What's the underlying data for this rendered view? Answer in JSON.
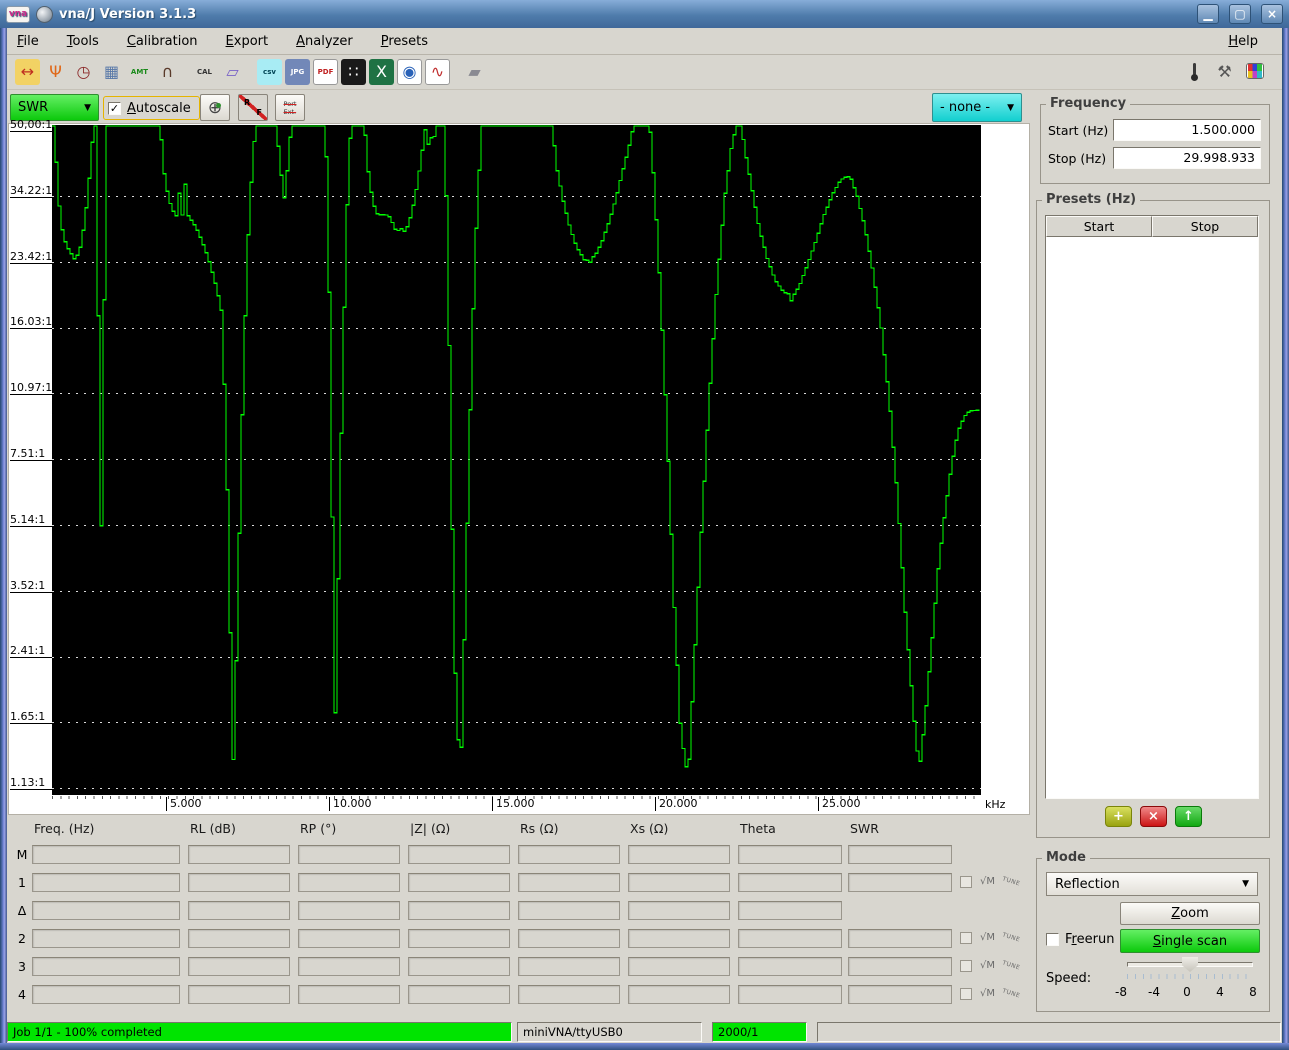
{
  "window": {
    "title": "vna/J Version 3.1.3",
    "logo": "vna"
  },
  "icons": {
    "minimize": "▁",
    "restore": "▢",
    "close": "×",
    "plus": "+",
    "delete": "×",
    "up": "↑",
    "check": "✓",
    "combo_arrow": "▼",
    "smith": "⊕",
    "sqrt_m": "√M",
    "tune": "TUNE"
  },
  "menu": {
    "items": [
      "File",
      "Tools",
      "Calibration",
      "Export",
      "Analyzer",
      "Presets"
    ],
    "help": "Help"
  },
  "toolbar": {
    "groups": [
      [
        {
          "name": "frequency-range-icon",
          "glyph": "↔",
          "fg": "#c03020",
          "bg": "#f2d264"
        },
        {
          "name": "antenna-icon",
          "glyph": "Ψ",
          "fg": "#e06818"
        },
        {
          "name": "clock-icon",
          "glyph": "◷",
          "fg": "#8c2a2a"
        },
        {
          "name": "calculator-icon",
          "glyph": "▦",
          "fg": "#5878a8"
        },
        {
          "name": "scale-letters-icon",
          "glyph": "AMT",
          "fg": "#1a8a1a",
          "small": true
        },
        {
          "name": "magnet-icon",
          "glyph": "∩",
          "fg": "#5a3a2a"
        }
      ],
      [
        {
          "name": "calibration-icon",
          "glyph": "CAL",
          "fg": "#333333",
          "small": true
        },
        {
          "name": "open-folder-icon",
          "glyph": "▱",
          "fg": "#7a62c8"
        }
      ],
      [
        {
          "name": "export-csv-icon",
          "glyph": "csv",
          "fg": "#004455",
          "bg": "#a8ecf4",
          "small": true
        },
        {
          "name": "export-jpg-icon",
          "glyph": "JPG",
          "fg": "#ffffff",
          "bg": "#7288b8",
          "small": true
        },
        {
          "name": "export-pdf-icon",
          "glyph": "PDF",
          "fg": "#c02020",
          "bg": "#ffffff",
          "bd": "#999999",
          "small": true
        },
        {
          "name": "export-sample-icon",
          "glyph": "∷",
          "fg": "#ffffff",
          "bg": "#1a1a1a"
        },
        {
          "name": "export-xls-icon",
          "glyph": "X",
          "fg": "#ffffff",
          "bg": "#1f7244"
        },
        {
          "name": "export-report-icon",
          "glyph": "◉",
          "fg": "#2a62b8",
          "bg": "#ffffff",
          "bd": "#999999"
        },
        {
          "name": "export-chart-icon",
          "glyph": "∿",
          "fg": "#c03030",
          "bg": "#ffffff",
          "bd": "#999999"
        }
      ],
      [
        {
          "name": "eraser-icon",
          "glyph": "▰",
          "fg": "#8a8a92"
        }
      ]
    ],
    "right": [
      {
        "name": "temperature-icon",
        "cls": "thermo"
      },
      {
        "name": "settings-icon",
        "glyph": "⚒",
        "fg": "#555555"
      },
      {
        "name": "color-scheme-icon",
        "cls": "palette"
      }
    ]
  },
  "scalebar": {
    "left_scale": "SWR",
    "autoscale_label": "Autoscale",
    "autoscale_checked": true,
    "right_scale": "- none -",
    "rf_r": "R",
    "rf_f": "F",
    "port_line1": "Port",
    "port_line2": "Ext."
  },
  "chart_data": {
    "type": "line",
    "x_unit": "kHz",
    "x_range_khz": [
      1500,
      29998.933
    ],
    "x_ticks": {
      "labels": [
        "5.000",
        "10.000",
        "15.000",
        "20.000",
        "25.000"
      ],
      "values_khz": [
        5000,
        10000,
        15000,
        20000,
        25000
      ]
    },
    "y_axis": {
      "scale": "log",
      "tick_labels": [
        "50,00:1",
        "34.22:1",
        "23.42:1",
        "16.03:1",
        "10.97:1",
        "7.51:1",
        "5.14:1",
        "3.52:1",
        "2.41:1",
        "1.65:1",
        "1.13:1"
      ],
      "tick_values": [
        50.0,
        34.22,
        23.42,
        16.03,
        10.97,
        7.51,
        5.14,
        3.52,
        2.41,
        1.65,
        1.13
      ]
    },
    "plot_bg": "#000000",
    "grid_color": "#ffffff",
    "clipped_at_top_swr": 50,
    "series": [
      {
        "name": "SWR",
        "color": "#00ff00",
        "points_khz_swr": [
          [
            1500,
            55
          ],
          [
            1560,
            46
          ],
          [
            1620,
            38
          ],
          [
            1700,
            31
          ],
          [
            1810,
            27
          ],
          [
            1930,
            25.5
          ],
          [
            2050,
            24.5
          ],
          [
            2140,
            24
          ],
          [
            2175,
            22.6
          ],
          [
            2210,
            24
          ],
          [
            2330,
            25.5
          ],
          [
            2450,
            29
          ],
          [
            2570,
            35
          ],
          [
            2670,
            44
          ],
          [
            2740,
            55
          ],
          [
            2800,
            55
          ],
          [
            2850,
            30
          ],
          [
            2900,
            12
          ],
          [
            2940,
            6.5
          ],
          [
            2972,
            5.1
          ],
          [
            3000,
            6.5
          ],
          [
            3040,
            12
          ],
          [
            3090,
            30
          ],
          [
            3140,
            55
          ],
          [
            4782,
            55
          ],
          [
            4880,
            40
          ],
          [
            5000,
            35
          ],
          [
            5120,
            32
          ],
          [
            5240,
            30.7
          ],
          [
            5340,
            30.2
          ],
          [
            5400,
            42
          ],
          [
            5460,
            30.2
          ],
          [
            5520,
            44
          ],
          [
            5580,
            30.2
          ],
          [
            5640,
            30.5
          ],
          [
            5760,
            29.5
          ],
          [
            5880,
            28.5
          ],
          [
            6050,
            26.5
          ],
          [
            6250,
            24
          ],
          [
            6450,
            21
          ],
          [
            6650,
            18
          ],
          [
            6800,
            9
          ],
          [
            6900,
            3.5
          ],
          [
            7022,
            1.33
          ],
          [
            7130,
            2.6
          ],
          [
            7230,
            6
          ],
          [
            7350,
            14
          ],
          [
            7500,
            30
          ],
          [
            7650,
            46
          ],
          [
            7750,
            55
          ],
          [
            8350,
            55
          ],
          [
            8450,
            41
          ],
          [
            8586,
            33.8
          ],
          [
            8700,
            41
          ],
          [
            8800,
            55
          ],
          [
            9850,
            55
          ],
          [
            9950,
            25
          ],
          [
            10050,
            6
          ],
          [
            10151,
            1.74
          ],
          [
            10250,
            4
          ],
          [
            10350,
            10
          ],
          [
            10470,
            25
          ],
          [
            10580,
            45
          ],
          [
            10650,
            55
          ],
          [
            11050,
            55
          ],
          [
            11150,
            40
          ],
          [
            11300,
            33
          ],
          [
            11450,
            30.7
          ],
          [
            11700,
            30.7
          ],
          [
            11850,
            30.2
          ],
          [
            11950,
            28.5
          ],
          [
            12050,
            27.8
          ],
          [
            12150,
            28.5
          ],
          [
            12250,
            27.8
          ],
          [
            12350,
            28.5
          ],
          [
            12500,
            31
          ],
          [
            12650,
            36
          ],
          [
            12800,
            43
          ],
          [
            12900,
            55
          ],
          [
            12980,
            44
          ],
          [
            13060,
            55
          ],
          [
            13140,
            44
          ],
          [
            13220,
            55
          ],
          [
            13500,
            55
          ],
          [
            13600,
            25
          ],
          [
            13700,
            8
          ],
          [
            13800,
            2.5
          ],
          [
            13985,
            1.16
          ],
          [
            14100,
            2.5
          ],
          [
            14220,
            6
          ],
          [
            14350,
            15
          ],
          [
            14500,
            32
          ],
          [
            14650,
            55
          ],
          [
            16800,
            55
          ],
          [
            16950,
            40
          ],
          [
            17150,
            33
          ],
          [
            17350,
            28.5
          ],
          [
            17550,
            25.5
          ],
          [
            17750,
            24
          ],
          [
            17850,
            23.2
          ],
          [
            17900,
            23.9
          ],
          [
            17960,
            23.2
          ],
          [
            18020,
            23.9
          ],
          [
            18150,
            24.5
          ],
          [
            18350,
            26.5
          ],
          [
            18550,
            29.5
          ],
          [
            18750,
            33.5
          ],
          [
            18950,
            39
          ],
          [
            19150,
            45
          ],
          [
            19300,
            55
          ],
          [
            19800,
            55
          ],
          [
            19950,
            35
          ],
          [
            20150,
            18
          ],
          [
            20350,
            8
          ],
          [
            20550,
            3.2
          ],
          [
            20750,
            1.55
          ],
          [
            20979,
            1.19
          ],
          [
            21150,
            2.2
          ],
          [
            21350,
            4.5
          ],
          [
            21600,
            10
          ],
          [
            21850,
            20
          ],
          [
            22100,
            34
          ],
          [
            22300,
            45
          ],
          [
            22451,
            55
          ],
          [
            22600,
            55
          ],
          [
            22750,
            43
          ],
          [
            22950,
            35
          ],
          [
            23150,
            28.5
          ],
          [
            23400,
            23.9
          ],
          [
            23650,
            21
          ],
          [
            23900,
            19.7
          ],
          [
            24077,
            19.4
          ],
          [
            24150,
            18.6
          ],
          [
            24230,
            19.4
          ],
          [
            24400,
            20.5
          ],
          [
            24650,
            23.2
          ],
          [
            24900,
            26.5
          ],
          [
            25150,
            30.7
          ],
          [
            25400,
            34.5
          ],
          [
            25650,
            37.5
          ],
          [
            25825,
            38.2
          ],
          [
            25950,
            38.2
          ],
          [
            26150,
            34.5
          ],
          [
            26400,
            28.5
          ],
          [
            26650,
            22
          ],
          [
            26900,
            16
          ],
          [
            27150,
            10.5
          ],
          [
            27400,
            6
          ],
          [
            27650,
            3
          ],
          [
            27900,
            1.7
          ],
          [
            28065,
            1.25
          ],
          [
            28250,
            1.7
          ],
          [
            28450,
            2.6
          ],
          [
            28650,
            4
          ],
          [
            28850,
            5.5
          ],
          [
            29050,
            7.2
          ],
          [
            29250,
            8.8
          ],
          [
            29450,
            9.6
          ],
          [
            29600,
            9.9
          ],
          [
            29998,
            10.0
          ]
        ]
      }
    ]
  },
  "marker_table": {
    "headers": [
      "Freq. (Hz)",
      "RL (dB)",
      "RP (°)",
      "|Z| (Ω)",
      "Rs (Ω)",
      "Xs (Ω)",
      "Theta",
      "SWR"
    ],
    "rows": [
      {
        "label": "M",
        "fields": 8,
        "has_extras": false
      },
      {
        "label": "1",
        "fields": 8,
        "has_extras": true
      },
      {
        "label": "Δ",
        "fields": 7,
        "has_extras": false
      },
      {
        "label": "2",
        "fields": 8,
        "has_extras": true
      },
      {
        "label": "3",
        "fields": 8,
        "has_extras": true
      },
      {
        "label": "4",
        "fields": 8,
        "has_extras": true
      }
    ],
    "field_value": ""
  },
  "frequency_panel": {
    "title": "Frequency",
    "start_label": "Start (Hz)",
    "start_value": "1.500.000",
    "stop_label": "Stop (Hz)",
    "stop_value": "29.998.933"
  },
  "presets_panel": {
    "title": "Presets (Hz)",
    "columns": [
      "Start",
      "Stop"
    ],
    "rows": []
  },
  "mode_panel": {
    "title": "Mode",
    "mode_value": "Reflection",
    "zoom_label": "Zoom",
    "freerun_pre": "F",
    "freerun_mn": "r",
    "freerun_suf": "eerun",
    "freerun_checked": false,
    "scan_label": "Single scan",
    "speed_label": "Speed:",
    "speed_value": 0,
    "speed_ticks": [
      "-8",
      "-4",
      "0",
      "4",
      "8"
    ]
  },
  "statusbar": {
    "progress_text": "Job 1/1 - 100% completed",
    "progress_percent": 100,
    "device": "miniVNA/ttyUSB0",
    "counter": "2000/1"
  },
  "colors": {
    "accent_green": "#00e400",
    "accent_cyan": "#12cfcf",
    "trace_green": "#00ff00",
    "titlebar_blue": "#4f7cab"
  }
}
